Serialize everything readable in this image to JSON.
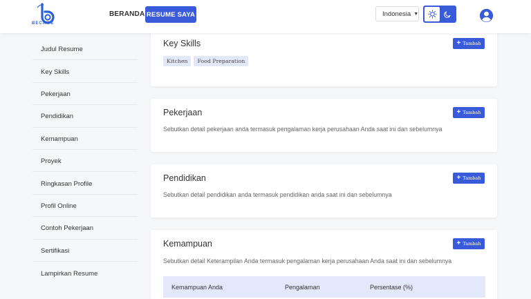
{
  "header": {
    "logo_text": "BECAWE",
    "nav_home": "BERANDA",
    "nav_resume": "RESUME SAYA",
    "language": "Indonesia",
    "accent": "#3a5bd9"
  },
  "sidebar": {
    "items": [
      {
        "label": "Judul Resume"
      },
      {
        "label": "Key Skills"
      },
      {
        "label": "Pekerjaan"
      },
      {
        "label": "Pendidikan"
      },
      {
        "label": "Kemampuan"
      },
      {
        "label": "Proyek"
      },
      {
        "label": "Ringkasan Profile"
      },
      {
        "label": "Profil Online"
      },
      {
        "label": "Contoh Pekerjaan"
      },
      {
        "label": "Sertifikasi"
      },
      {
        "label": "Lampirkan Resume"
      }
    ]
  },
  "add_label": "Tambah",
  "key_skills": {
    "title": "Key Skills",
    "tags": [
      "Kitchen",
      "Food Preparation"
    ]
  },
  "pekerjaan": {
    "title": "Pekerjaan",
    "desc": "Sebutkan detail pekerjaan anda termasuk pengalaman kerja perusahaan Anda saat ini dan sebelumnya"
  },
  "pendidikan": {
    "title": "Pendidikan",
    "desc": "Sebutkan detail pendidikan anda termasuk pendidikan anda saat ini dan sebelumnya"
  },
  "kemampuan": {
    "title": "Kemampuan",
    "desc": "Sebutkan detail Keterampilan Anda termasuk pengalaman kerja perusahaan Anda saat ini dan sebelumnya",
    "columns": [
      "Kemampuan Anda",
      "Pengalaman",
      "Persentase (%)"
    ]
  }
}
